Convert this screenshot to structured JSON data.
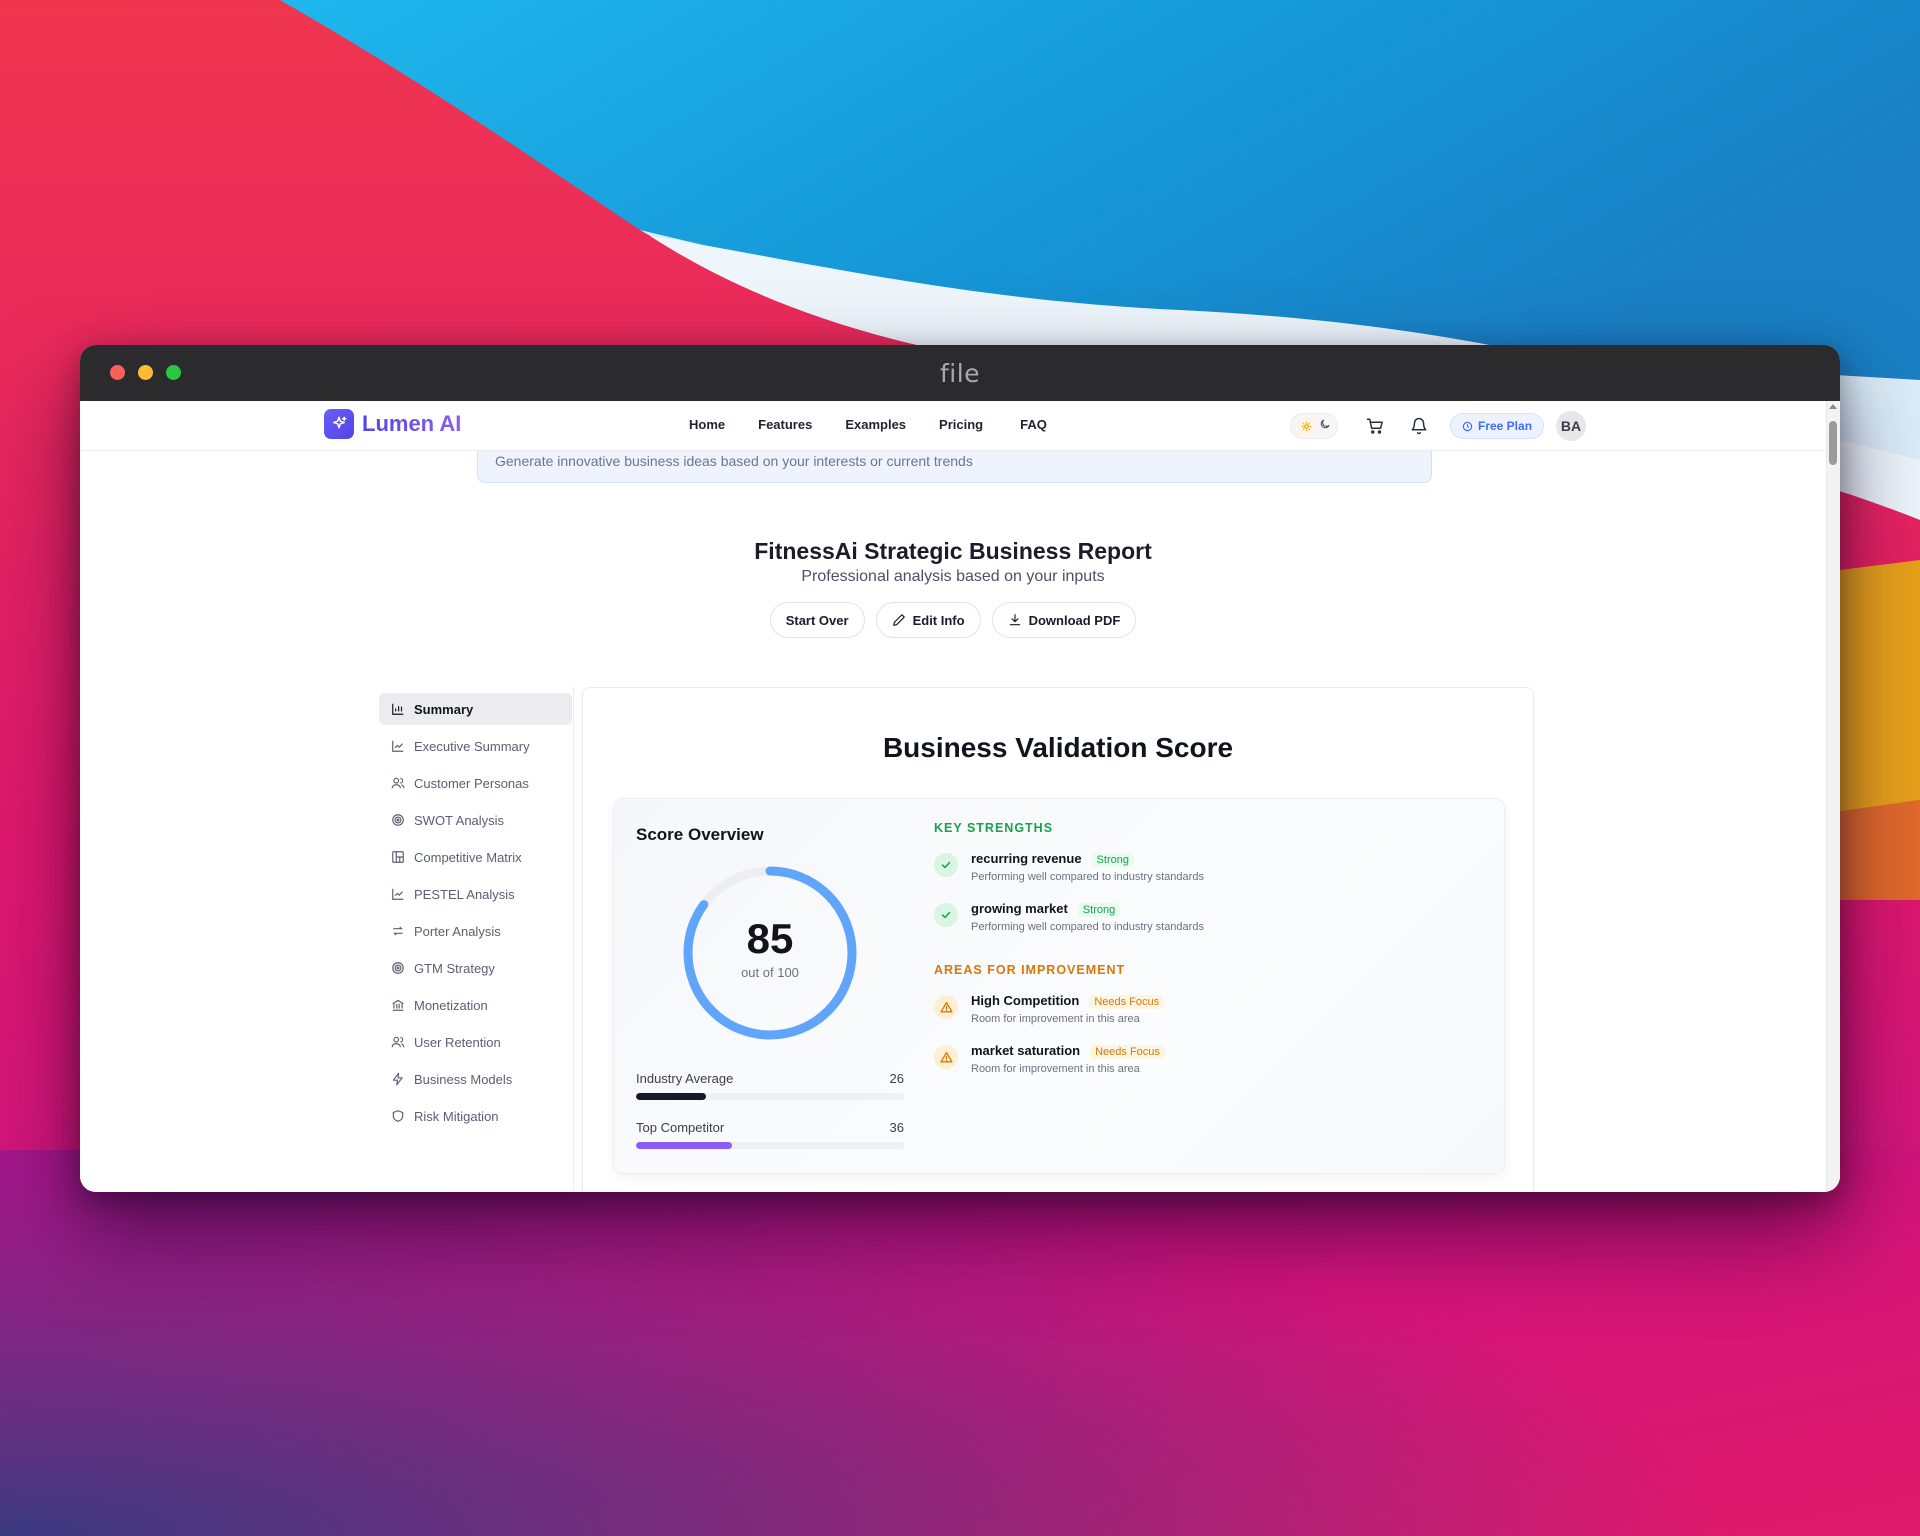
{
  "window": {
    "title": "file"
  },
  "banner": {
    "text": "Generate innovative business ideas based on your interests or current trends"
  },
  "navbar": {
    "brand": "Lumen AI",
    "links": [
      "Home",
      "Features",
      "Examples",
      "Pricing",
      "FAQ"
    ],
    "plan": "Free Plan",
    "avatar_initials": "BA"
  },
  "report": {
    "title": "FitnessAi Strategic Business Report",
    "subtitle": "Professional analysis based on your inputs",
    "actions": {
      "start_over": "Start Over",
      "edit_info": "Edit Info",
      "download_pdf": "Download PDF"
    }
  },
  "sidebar": {
    "items": [
      {
        "label": "Summary",
        "icon": "bar-chart-icon"
      },
      {
        "label": "Executive Summary",
        "icon": "line-chart-icon"
      },
      {
        "label": "Customer Personas",
        "icon": "users-icon"
      },
      {
        "label": "SWOT Analysis",
        "icon": "target-icon"
      },
      {
        "label": "Competitive Matrix",
        "icon": "grid-icon"
      },
      {
        "label": "PESTEL Analysis",
        "icon": "line-chart-icon"
      },
      {
        "label": "Porter Analysis",
        "icon": "arrows-icon"
      },
      {
        "label": "GTM Strategy",
        "icon": "target-icon"
      },
      {
        "label": "Monetization",
        "icon": "bank-icon"
      },
      {
        "label": "User Retention",
        "icon": "users-icon"
      },
      {
        "label": "Business Models",
        "icon": "bolt-icon"
      },
      {
        "label": "Risk Mitigation",
        "icon": "shield-icon"
      }
    ],
    "active_index": 0
  },
  "panel": {
    "title": "Business Validation Score",
    "score_overview_label": "Score Overview",
    "score": 85,
    "score_max": 100,
    "score_caption": "out of 100",
    "benchmarks": [
      {
        "label": "Industry Average",
        "value": 26,
        "color": "#141a2b"
      },
      {
        "label": "Top Competitor",
        "value": 36,
        "color": "#8b5cf6"
      }
    ],
    "strengths_heading": "KEY STRENGTHS",
    "strengths": [
      {
        "name": "recurring revenue",
        "tag": "Strong",
        "desc": "Performing well compared to industry standards"
      },
      {
        "name": "growing market",
        "tag": "Strong",
        "desc": "Performing well compared to industry standards"
      }
    ],
    "improvements_heading": "AREAS FOR IMPROVEMENT",
    "improvements": [
      {
        "name": "High Competition",
        "tag": "Needs Focus",
        "desc": "Room for improvement in this area"
      },
      {
        "name": "market saturation",
        "tag": "Needs Focus",
        "desc": "Room for improvement in this area"
      }
    ]
  },
  "colors": {
    "accent": "#4f46e5",
    "gauge": "#60a5fa",
    "strength": "#16a34a",
    "improvement": "#d97706"
  }
}
